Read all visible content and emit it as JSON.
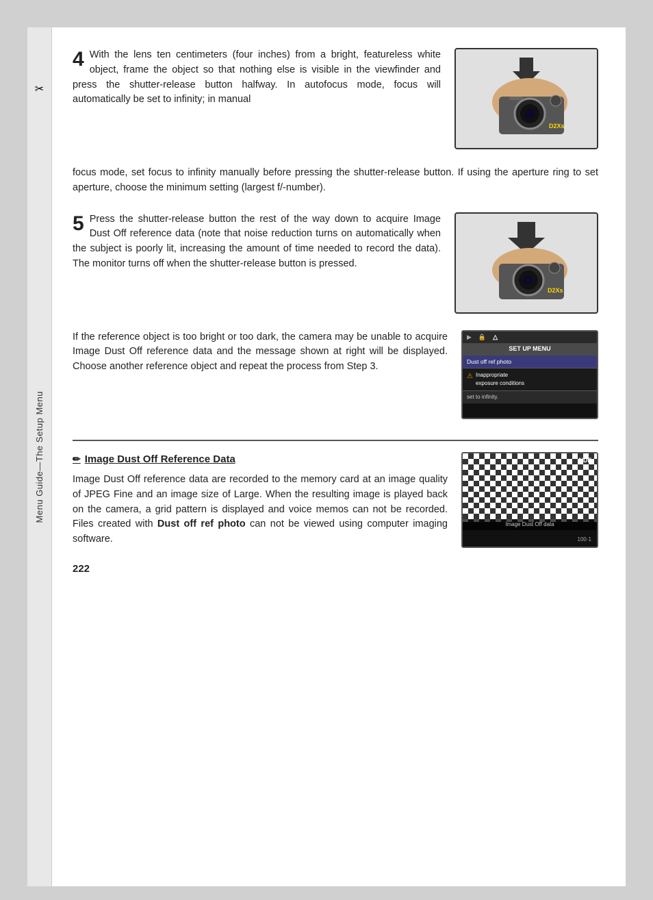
{
  "sidebar": {
    "icon": "✂",
    "text": "Menu Guide—The Setup Menu"
  },
  "step4": {
    "number": "4",
    "text1": "With the lens ten centimeters (four inches) from a bright, featureless white object, frame the object so that nothing else is visible in the viewfinder and press the shutter-release button halfway.  In autofocus mode, focus will automatically be set to infinity; in manual",
    "text2": "focus mode, set focus to infinity manually before pressing the shutter-release button.  If using the aperture ring to set aperture, choose the minimum setting (largest f/-number)."
  },
  "step5": {
    "number": "5",
    "text": "Press the shutter-release button the rest of the way down to acquire Image Dust Off reference data (note that noise reduction turns on automatically when the subject is poorly lit, increasing the amount of time needed to record the data).  The monitor turns off when the shutter-release button is pressed."
  },
  "toobright": {
    "text": "If the reference object is too bright or too dark, the camera may be unable to acquire Image Dust Off reference data and the message shown at right will be displayed.  Choose another reference object and repeat the process from Step 3."
  },
  "menu_screenshot": {
    "title": "SET UP MENU",
    "item": "Dust off ref photo",
    "warning_label": "Inappropriate",
    "warning_sub": "exposure conditions",
    "info": "set to infinity.",
    "icons": [
      "▶",
      "🔒",
      "△"
    ]
  },
  "ref_section": {
    "title": "Image Dust Off Reference Data",
    "icon": "✏",
    "text": "Image Dust Off reference data are recorded to the memory card at an image quality of JPEG Fine and an image size of Large.  When the resulting image is played back on the camera, a grid pattern is displayed and voice memos can not be recorded.  Files created with ",
    "bold_text": "Dust off ref photo",
    "text2": " can not be viewed using computer imaging software.",
    "checker_label": "Image Dust Off data",
    "checker_ndf": "NDF",
    "checker_counter": "100·1"
  },
  "page": {
    "number": "222"
  }
}
